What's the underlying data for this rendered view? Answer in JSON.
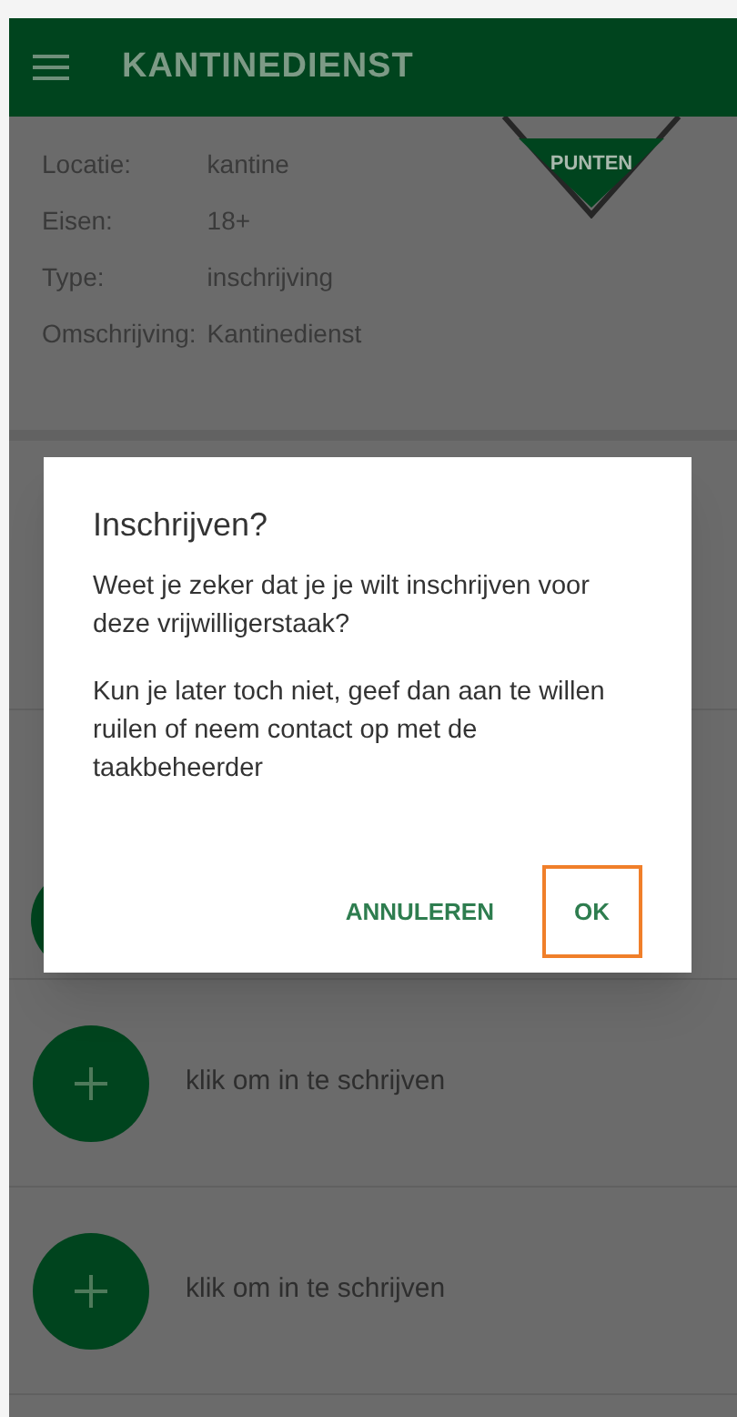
{
  "app_bar": {
    "title": "KANTINEDIENST"
  },
  "badge": {
    "label": "PUNTEN"
  },
  "details": [
    {
      "label": "Locatie:",
      "value": "kantine"
    },
    {
      "label": "Eisen:",
      "value": "18+"
    },
    {
      "label": "Type:",
      "value": "inschrijving"
    },
    {
      "label": "Omschrijving:",
      "value": "Kantinedienst"
    }
  ],
  "slots": [
    {
      "kind": "hidden"
    },
    {
      "kind": "hidden"
    },
    {
      "kind": "signup",
      "label": "klik om in te schrijven"
    },
    {
      "kind": "signup",
      "label": "klik om in te schrijven"
    }
  ],
  "dialog": {
    "title": "Inschrijven?",
    "paragraphs": [
      "Weet je zeker dat je je wilt inschrijven voor deze vrijwilligerstaak?",
      "Kun je later toch niet, geef dan aan te willen ruilen of neem contact op met de taakbeheerder"
    ],
    "buttons": [
      {
        "label": "ANNULEREN",
        "highlighted": false
      },
      {
        "label": "OK",
        "highlighted": true
      }
    ]
  }
}
